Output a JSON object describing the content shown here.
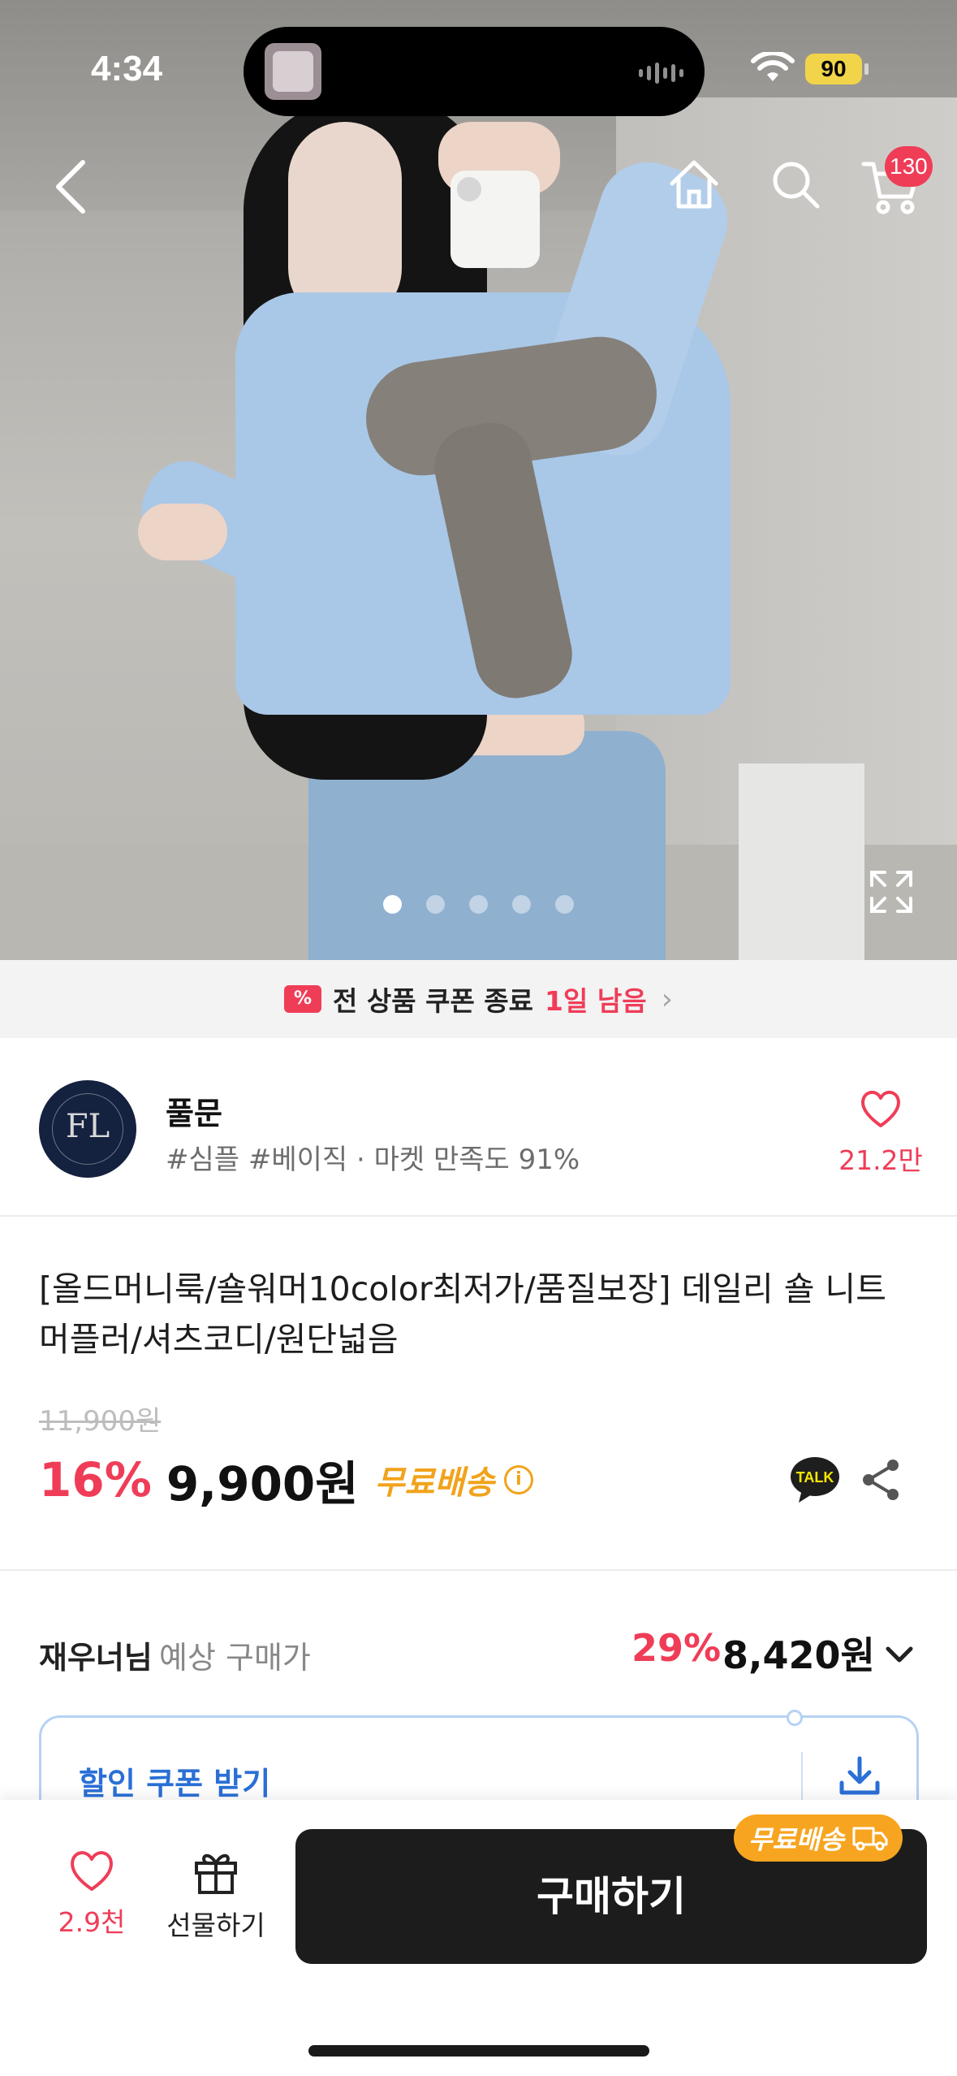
{
  "status_bar": {
    "time": "4:34",
    "battery": "90"
  },
  "nav": {
    "cart_count": "130"
  },
  "carousel": {
    "dot_count": 5,
    "active_index": 0
  },
  "coupon_banner": {
    "text": "전 상품 쿠폰 종료",
    "remaining": "1일 남음"
  },
  "seller": {
    "name": "풀문",
    "tags": "#심플 #베이직 · 마켓 만족도 91%",
    "likes": "21.2만",
    "logo_monogram": "FL"
  },
  "product": {
    "title": "[올드머니룩/숄워머10color최저가/품질보장] 데일리 숄 니트 머플러/셔츠코디/원단넓음",
    "original_price": "11,900원",
    "discount": "16%",
    "price": "9,900원",
    "shipping": "무료배송"
  },
  "expected_price": {
    "user": "재우너님",
    "label": "예상 구매가",
    "discount": "29%",
    "price": "8,420원"
  },
  "coupon": {
    "label": "할인 쿠폰 받기"
  },
  "bottom_bar": {
    "like_count": "2.9천",
    "gift_label": "선물하기",
    "buy_label": "구매하기",
    "shipping_badge": "무료배송"
  },
  "colors": {
    "accent": "#ef3d58",
    "shipping": "#f1a31b",
    "coupon_blue": "#2a6fd6",
    "buy_button": "#1c1c1c"
  }
}
